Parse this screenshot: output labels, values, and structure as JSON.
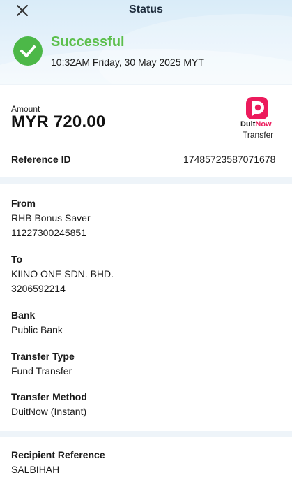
{
  "header": {
    "title": "Status",
    "status": "Successful",
    "datetime": "10:32AM Friday, 30 May 2025 MYT"
  },
  "colors": {
    "success": "#4cb848",
    "duitnow_brand": "#ec1b5c"
  },
  "icons": {
    "close": "close-icon",
    "status": "check-circle-icon",
    "brand": "duitnow-logo"
  },
  "summary": {
    "amount_label": "Amount",
    "amount": "MYR 720.00",
    "logo_text_1": "Duit",
    "logo_text_2": "Now",
    "logo_caption": "Transfer",
    "reference_label": "Reference ID",
    "reference_value": "17485723587071678"
  },
  "details": {
    "from_label": "From",
    "from_account_name": "RHB Bonus Saver",
    "from_account_no": "11227300245851",
    "to_label": "To",
    "to_name": "KIINO ONE SDN. BHD.",
    "to_account_no": "3206592214",
    "bank_label": "Bank",
    "bank_value": "Public Bank",
    "transfer_type_label": "Transfer Type",
    "transfer_type_value": "Fund Transfer",
    "transfer_method_label": "Transfer Method",
    "transfer_method_value": "DuitNow (Instant)"
  },
  "recipient": {
    "label": "Recipient Reference",
    "value": "SALBIHAH"
  }
}
